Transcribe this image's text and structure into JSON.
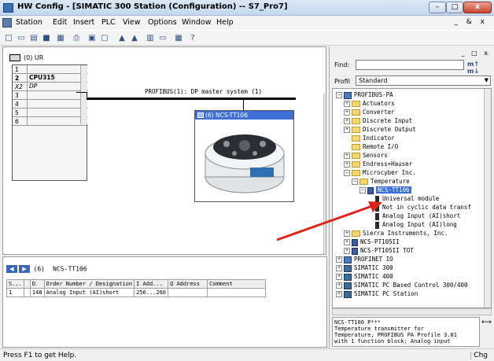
{
  "window": {
    "title": "HW Config - [SIMATIC 300 Station (Configuration) -- S7_Pro7]",
    "min": "–",
    "max": "□",
    "close": "x"
  },
  "menu": {
    "items": [
      "Station",
      "Edit",
      "Insert",
      "PLC",
      "View",
      "Options",
      "Window",
      "Help"
    ],
    "right": "_ & x"
  },
  "station": {
    "rack_label": "(0) UR",
    "rack_rows": [
      {
        "slot": "1",
        "module": ""
      },
      {
        "slot": "2",
        "module": "CPU315"
      },
      {
        "slot": "X2",
        "module": "DP"
      },
      {
        "slot": "3",
        "module": ""
      },
      {
        "slot": "4",
        "module": ""
      },
      {
        "slot": "5",
        "module": ""
      },
      {
        "slot": "6",
        "module": ""
      }
    ],
    "bus_label": "PROFIBUS(1): DP master system (1)",
    "device_title": "(6) NCS-TT106"
  },
  "detail": {
    "slot_label": "(6)",
    "device_label": "NCS-TT106",
    "columns": [
      "S...",
      "",
      "D",
      "Order Number / Designation",
      "I Add...",
      "Q Address",
      "Comment"
    ],
    "rows": [
      [
        "1",
        "",
        "148",
        "Analog Input (AI)short",
        "256...260",
        "",
        ""
      ]
    ]
  },
  "catalog": {
    "top_icons": "_ □ x",
    "find_label": "Find:",
    "find_value": "",
    "find_btns": "m↑ m↓",
    "profile_label": "Profil",
    "profile_value": "Standard",
    "tree": [
      {
        "indent": 0,
        "exp": "−",
        "icon": "net",
        "label": "PROFIBUS-PA"
      },
      {
        "indent": 1,
        "exp": "+",
        "icon": "folder",
        "label": "Actuators"
      },
      {
        "indent": 1,
        "exp": "+",
        "icon": "folder",
        "label": "Converter"
      },
      {
        "indent": 1,
        "exp": "+",
        "icon": "folder",
        "label": "Discrete Input"
      },
      {
        "indent": 1,
        "exp": "+",
        "icon": "folder",
        "label": "Discrete Output"
      },
      {
        "indent": 1,
        "exp": "",
        "icon": "folder",
        "label": "Indicator"
      },
      {
        "indent": 1,
        "exp": "",
        "icon": "folder",
        "label": "Remote I/O"
      },
      {
        "indent": 1,
        "exp": "+",
        "icon": "folder",
        "label": "Sensors"
      },
      {
        "indent": 1,
        "exp": "+",
        "icon": "folder",
        "label": "Endress+Hauser"
      },
      {
        "indent": 1,
        "exp": "−",
        "icon": "folder",
        "label": "Microcyber Inc."
      },
      {
        "indent": 2,
        "exp": "−",
        "icon": "folder",
        "label": "Temperature"
      },
      {
        "indent": 3,
        "exp": "−",
        "icon": "device",
        "label": "NCS-TT106",
        "selected": true
      },
      {
        "indent": 4,
        "exp": "",
        "icon": "module",
        "label": "Universal module"
      },
      {
        "indent": 4,
        "exp": "",
        "icon": "module",
        "label": "Not in cyclic data transf"
      },
      {
        "indent": 4,
        "exp": "",
        "icon": "module",
        "label": "Analog Input (AI)short"
      },
      {
        "indent": 4,
        "exp": "",
        "icon": "module",
        "label": "Analog Input (AI)long"
      },
      {
        "indent": 1,
        "exp": "+",
        "icon": "folder",
        "label": "Sierra Instruments, Inc."
      },
      {
        "indent": 1,
        "exp": "+",
        "icon": "device",
        "label": "NCS-PT105II"
      },
      {
        "indent": 1,
        "exp": "+",
        "icon": "device",
        "label": "NCS-PT105II TOT"
      },
      {
        "indent": 0,
        "exp": "+",
        "icon": "net",
        "label": "PROFINET IO"
      },
      {
        "indent": 0,
        "exp": "+",
        "icon": "station",
        "label": "SIMATIC 300"
      },
      {
        "indent": 0,
        "exp": "+",
        "icon": "station",
        "label": "SIMATIC 400"
      },
      {
        "indent": 0,
        "exp": "+",
        "icon": "station",
        "label": "SIMATIC PC Based Control 300/400"
      },
      {
        "indent": 0,
        "exp": "+",
        "icon": "station",
        "label": "SIMATIC PC Station"
      }
    ],
    "description": [
      "NCS-TT106 P***",
      "Temperature transmitter for",
      "Temperature, PROFIBUS PA Profile 3.01",
      "with 1 function block: Analog input"
    ]
  },
  "status": {
    "text": "Press F1 to get Help.",
    "right": "Chg"
  },
  "colors": {
    "selection": "#3b6fd6",
    "arrow": "#e0221b"
  }
}
